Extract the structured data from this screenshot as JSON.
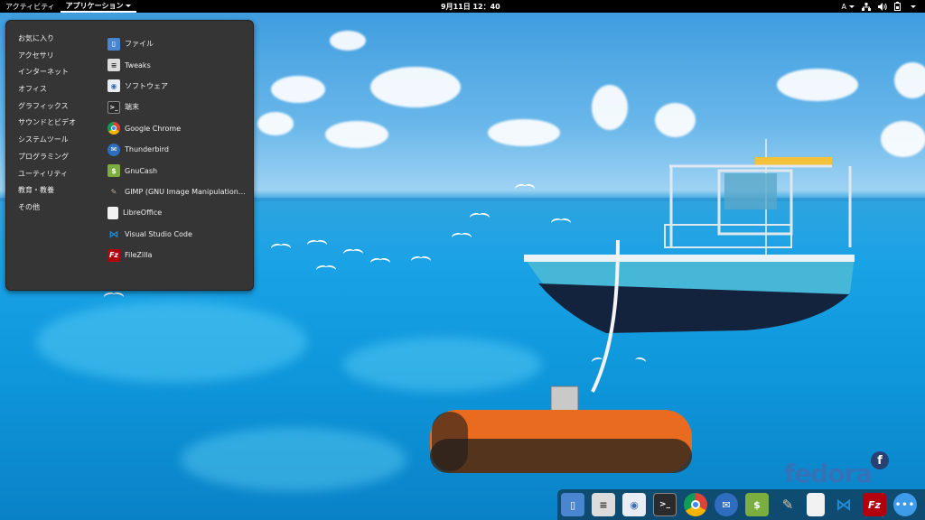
{
  "topbar": {
    "activities": "アクティビティ",
    "applications": "アプリケーション",
    "clock": "9月11日 12：40",
    "input_method": "A"
  },
  "menu": {
    "categories": [
      "お気に入り",
      "アクセサリ",
      "インターネット",
      "オフィス",
      "グラフィックス",
      "サウンドとビデオ",
      "システムツール",
      "プログラミング",
      "ユーティリティ",
      "教育・教養",
      "その他"
    ],
    "apps": [
      {
        "label": "ファイル",
        "icon": "files-icon",
        "color": "#4a86cf"
      },
      {
        "label": "Tweaks",
        "icon": "tweaks-icon",
        "color": "#dcdcdc"
      },
      {
        "label": "ソフトウェア",
        "icon": "software-icon",
        "color": "#e9eef4"
      },
      {
        "label": "端末",
        "icon": "terminal-icon",
        "color": "#2b2b2b"
      },
      {
        "label": "Google Chrome",
        "icon": "chrome-icon",
        "color": "#db4437"
      },
      {
        "label": "Thunderbird",
        "icon": "thunderbird-icon",
        "color": "#2f6dbf"
      },
      {
        "label": "GnuCash",
        "icon": "gnucash-icon",
        "color": "#7bae3e"
      },
      {
        "label": "GIMP (GNU Image Manipulation…",
        "icon": "gimp-icon",
        "color": "#8a7f6a"
      },
      {
        "label": "LibreOffice",
        "icon": "libreoffice-icon",
        "color": "#f2f2f2"
      },
      {
        "label": "Visual Studio Code",
        "icon": "vscode-icon",
        "color": "#1f8ad2"
      },
      {
        "label": "FileZilla",
        "icon": "filezilla-icon",
        "color": "#b2000f"
      }
    ]
  },
  "watermark": "fedora",
  "dock": {
    "items": [
      {
        "icon": "files-icon",
        "color": "#4a86cf"
      },
      {
        "icon": "tweaks-icon",
        "color": "#dcdcdc"
      },
      {
        "icon": "software-icon",
        "color": "#e9eef4"
      },
      {
        "icon": "terminal-icon",
        "color": "#2b2b2b"
      },
      {
        "icon": "chrome-icon",
        "color": "#db4437"
      },
      {
        "icon": "thunderbird-icon",
        "color": "#2f6dbf"
      },
      {
        "icon": "gnucash-icon",
        "color": "#7bae3e"
      },
      {
        "icon": "gimp-icon",
        "color": "#8a7f6a"
      },
      {
        "icon": "libreoffice-icon",
        "color": "#f2f2f2"
      },
      {
        "icon": "vscode-icon",
        "color": "#1f8ad2"
      },
      {
        "icon": "filezilla-icon",
        "color": "#b2000f"
      },
      {
        "icon": "show-apps-icon",
        "color": "#3d9be9"
      }
    ]
  }
}
